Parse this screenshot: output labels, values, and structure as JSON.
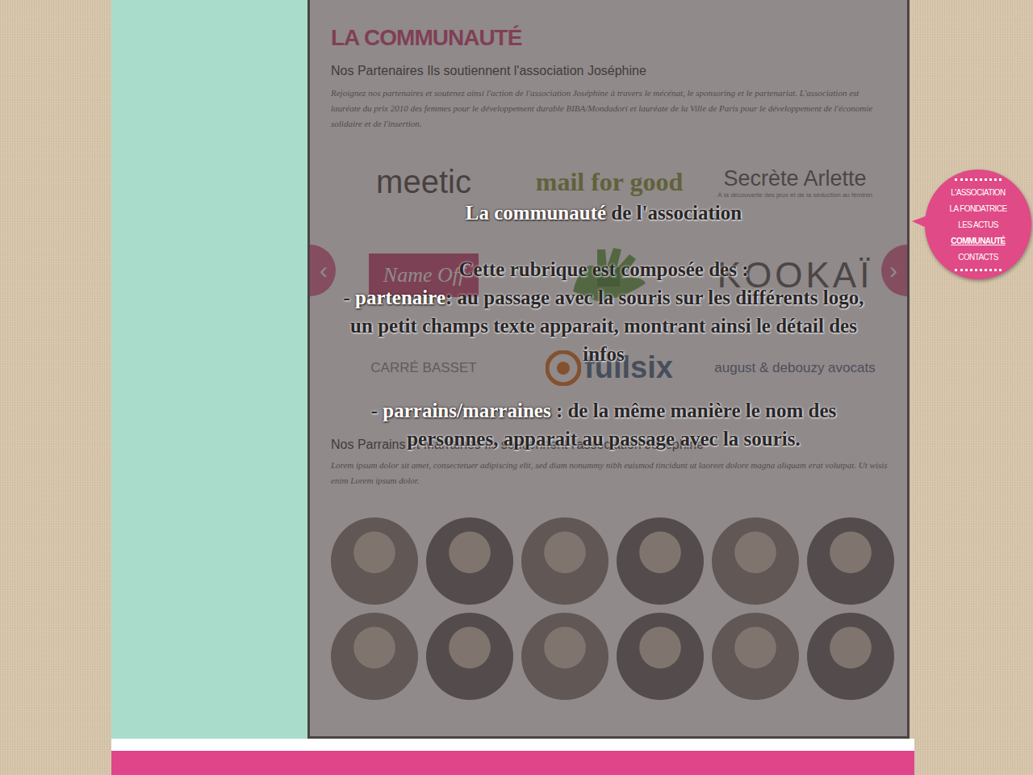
{
  "page": {
    "title": "LA COMMUNAUTÉ",
    "partners_heading": "Nos Partenaires Ils soutiennent l'association Joséphine",
    "partners_intro": "Rejoignez nos partenaires et soutenez ainsi l'action de l'association Joséphine à travers le mécénat, le sponsoring et le partenariat. L'association est lauréate du prix 2010 des femmes pour le développement durable BIBA/Mondadori et lauréate de la Ville de Paris pour le développement de l'économie solidaire et de l'insertion.",
    "partners": [
      {
        "kind": "meetic",
        "name": "meetic",
        "tagline": "",
        "color": "#4a4a4a"
      },
      {
        "kind": "mailforgood",
        "name": "mail for good",
        "tagline": "",
        "color": "#8a9a3a"
      },
      {
        "kind": "arlette",
        "name": "Secrète Arlette",
        "tagline": "À la découverte des jeux et de la séduction au féminin",
        "color": "#555555"
      },
      {
        "kind": "boxed",
        "name": "Name Off",
        "tagline": "",
        "color": "#d04a7a"
      },
      {
        "kind": "graphic",
        "name": "",
        "tagline": "",
        "color": "#6aa84f"
      },
      {
        "kind": "kookai",
        "name": "KOOKAÏ",
        "tagline": "",
        "color": "#555555"
      },
      {
        "kind": "small",
        "name": "CARRÉ BASSET",
        "tagline": "",
        "color": "#8a8a8a"
      },
      {
        "kind": "fullsix",
        "name": "fullsix",
        "tagline": "",
        "color": "#e07020"
      },
      {
        "kind": "small",
        "name": "august & debouzy avocats",
        "tagline": "",
        "color": "#5a6a8a"
      }
    ],
    "sponsors_heading": "Nos Parrains et Marraines Ils soutiennent l'association Joséphine",
    "sponsors_intro": "Lorem ipsum dolor sit amet, consectetuer adipiscing elit, sed diam nonummy nibh euismod tincidunt ut laoreet dolore magna aliquam erat volutpat. Ut wisis enim Lorem ipsum dolor.",
    "sponsors": [
      {
        "kind": "photo"
      },
      {
        "kind": "photo"
      },
      {
        "kind": "photo"
      },
      {
        "kind": "photo"
      },
      {
        "kind": "photo"
      },
      {
        "kind": "photo"
      },
      {
        "kind": "photo"
      },
      {
        "kind": "photo"
      },
      {
        "kind": "photo"
      },
      {
        "kind": "photo"
      },
      {
        "kind": "photo"
      },
      {
        "kind": "photo"
      }
    ],
    "arrows": {
      "prev": "‹",
      "next": "›"
    }
  },
  "nav": {
    "items": [
      {
        "label": "L'ASSOCIATION",
        "selected": false
      },
      {
        "label": "LA FONDATRICE",
        "selected": false
      },
      {
        "label": "LES ACTUS",
        "selected": false
      },
      {
        "label": "COMMUNAUTÉ",
        "selected": true
      },
      {
        "label": "CONTACTS",
        "selected": false
      }
    ]
  },
  "annotation": {
    "title_highlight": "La communauté",
    "title_rest": " de l'association",
    "intro": "Cette rubrique est composée des :",
    "items": [
      {
        "prefix": "- ",
        "highlight": "partenaire",
        "text": ": au passage avec la souris sur les différents logo, un petit champs texte apparait, montrant ainsi le détail des infos"
      },
      {
        "prefix": "- ",
        "highlight": "parrains/marraines",
        "text": " : de la même manière le nom des personnes, apparait au passage avec la souris."
      }
    ]
  }
}
